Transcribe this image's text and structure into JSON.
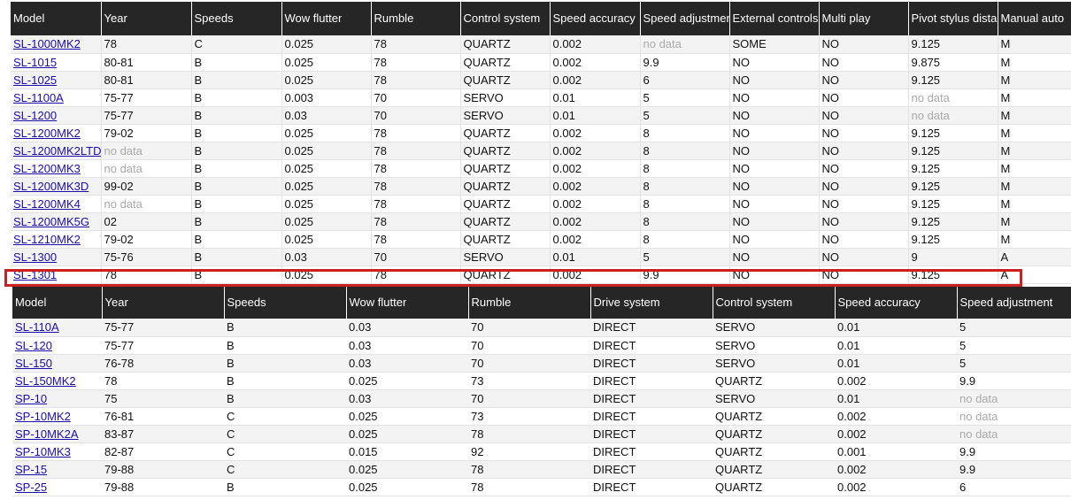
{
  "table1": {
    "columns": [
      "Model",
      "Year",
      "Speeds",
      "Wow flutter",
      "Rumble",
      "Control system",
      "Speed accuracy",
      "Speed adjustment",
      "External controls",
      "Multi play",
      "Pivot stylus distance",
      "Manual auto"
    ],
    "rows": [
      [
        "SL-1000MK2",
        "78",
        "C",
        "0.025",
        "78",
        "QUARTZ",
        "0.002",
        "no data",
        "SOME",
        "NO",
        "9.125",
        "M"
      ],
      [
        "SL-1015",
        "80-81",
        "B",
        "0.025",
        "78",
        "QUARTZ",
        "0.002",
        "9.9",
        "NO",
        "NO",
        "9.875",
        "M"
      ],
      [
        "SL-1025",
        "80-81",
        "B",
        "0.025",
        "78",
        "QUARTZ",
        "0.002",
        "6",
        "NO",
        "NO",
        "9.125",
        "M"
      ],
      [
        "SL-1100A",
        "75-77",
        "B",
        "0.003",
        "70",
        "SERVO",
        "0.01",
        "5",
        "NO",
        "NO",
        "no data",
        "M"
      ],
      [
        "SL-1200",
        "75-77",
        "B",
        "0.03",
        "70",
        "SERVO",
        "0.01",
        "5",
        "NO",
        "NO",
        "no data",
        "M"
      ],
      [
        "SL-1200MK2",
        "79-02",
        "B",
        "0.025",
        "78",
        "QUARTZ",
        "0.002",
        "8",
        "NO",
        "NO",
        "9.125",
        "M"
      ],
      [
        "SL-1200MK2LTD",
        "no data",
        "B",
        "0.025",
        "78",
        "QUARTZ",
        "0.002",
        "8",
        "NO",
        "NO",
        "9.125",
        "M"
      ],
      [
        "SL-1200MK3",
        "no data",
        "B",
        "0.025",
        "78",
        "QUARTZ",
        "0.002",
        "8",
        "NO",
        "NO",
        "9.125",
        "M"
      ],
      [
        "SL-1200MK3D",
        "99-02",
        "B",
        "0.025",
        "78",
        "QUARTZ",
        "0.002",
        "8",
        "NO",
        "NO",
        "9.125",
        "M"
      ],
      [
        "SL-1200MK4",
        "no data",
        "B",
        "0.025",
        "78",
        "QUARTZ",
        "0.002",
        "8",
        "NO",
        "NO",
        "9.125",
        "M"
      ],
      [
        "SL-1200MK5G",
        "02",
        "B",
        "0.025",
        "78",
        "QUARTZ",
        "0.002",
        "8",
        "NO",
        "NO",
        "9.125",
        "M"
      ],
      [
        "SL-1210MK2",
        "79-02",
        "B",
        "0.025",
        "78",
        "QUARTZ",
        "0.002",
        "8",
        "NO",
        "NO",
        "9.125",
        "M"
      ],
      [
        "SL-1300",
        "75-76",
        "B",
        "0.03",
        "70",
        "SERVO",
        "0.01",
        "5",
        "NO",
        "NO",
        "9",
        "A"
      ],
      [
        "SL-1301",
        "78",
        "B",
        "0.025",
        "78",
        "QUARTZ",
        "0.002",
        "9.9",
        "NO",
        "NO",
        "9.125",
        "A"
      ]
    ]
  },
  "table2": {
    "columns": [
      "Model",
      "Year",
      "Speeds",
      "Wow flutter",
      "Rumble",
      "Drive system",
      "Control system",
      "Speed accuracy",
      "Speed adjustment"
    ],
    "rows": [
      [
        "SL-110A",
        "75-77",
        "B",
        "0.03",
        "70",
        "DIRECT",
        "SERVO",
        "0.01",
        "5"
      ],
      [
        "SL-120",
        "75-77",
        "B",
        "0.03",
        "70",
        "DIRECT",
        "SERVO",
        "0.01",
        "5"
      ],
      [
        "SL-150",
        "76-78",
        "B",
        "0.03",
        "70",
        "DIRECT",
        "SERVO",
        "0.01",
        "5"
      ],
      [
        "SL-150MK2",
        "78",
        "B",
        "0.025",
        "73",
        "DIRECT",
        "QUARTZ",
        "0.002",
        "9.9"
      ],
      [
        "SP-10",
        "75",
        "B",
        "0.03",
        "70",
        "DIRECT",
        "SERVO",
        "0.01",
        "no data"
      ],
      [
        "SP-10MK2",
        "76-81",
        "C",
        "0.025",
        "73",
        "DIRECT",
        "QUARTZ",
        "0.002",
        "no data"
      ],
      [
        "SP-10MK2A",
        "83-87",
        "C",
        "0.025",
        "78",
        "DIRECT",
        "QUARTZ",
        "0.002",
        "no data"
      ],
      [
        "SP-10MK3",
        "82-87",
        "C",
        "0.015",
        "92",
        "DIRECT",
        "QUARTZ",
        "0.001",
        "9.9"
      ],
      [
        "SP-15",
        "79-88",
        "C",
        "0.025",
        "78",
        "DIRECT",
        "QUARTZ",
        "0.002",
        "9.9"
      ],
      [
        "SP-25",
        "79-88",
        "B",
        "0.025",
        "78",
        "DIRECT",
        "QUARTZ",
        "0.002",
        "6"
      ]
    ]
  },
  "highlight": {
    "row_model": "SL-1301",
    "color": "#cc1f1f"
  },
  "colors": {
    "header_bg": "#262626",
    "header_text": "#ffffff",
    "link": "#1a0dab",
    "no_data": "#aaaaaa",
    "row_alt": "#f3f3f3"
  }
}
